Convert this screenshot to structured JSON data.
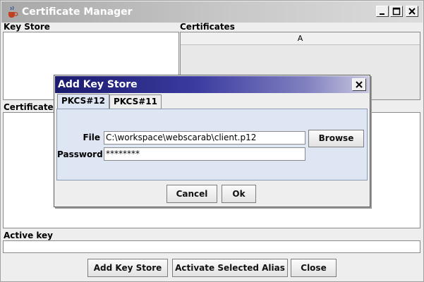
{
  "window": {
    "title": "Certificate Manager"
  },
  "main": {
    "key_store_label": "Key Store",
    "certificates_label": "Certificates",
    "certificates_column": "A",
    "certificate_details_label": "Certificate Details",
    "active_key_label": "Active key",
    "active_key_value": ""
  },
  "buttons": {
    "add_key_store": "Add Key Store",
    "activate_selected_alias": "Activate Selected Alias",
    "close": "Close"
  },
  "dialog": {
    "title": "Add Key Store",
    "tabs": [
      {
        "label": "PKCS#12",
        "selected": true
      },
      {
        "label": "PKCS#11",
        "selected": false
      }
    ],
    "file_label": "File",
    "file_value": "C:\\workspace\\webscarab\\client.p12",
    "browse_label": "Browse",
    "password_label": "Password",
    "password_value": "********",
    "cancel_label": "Cancel",
    "ok_label": "Ok"
  },
  "colors": {
    "dialog_title_start": "#1a1a6e",
    "tab_panel_bg": "#dde6f2"
  }
}
